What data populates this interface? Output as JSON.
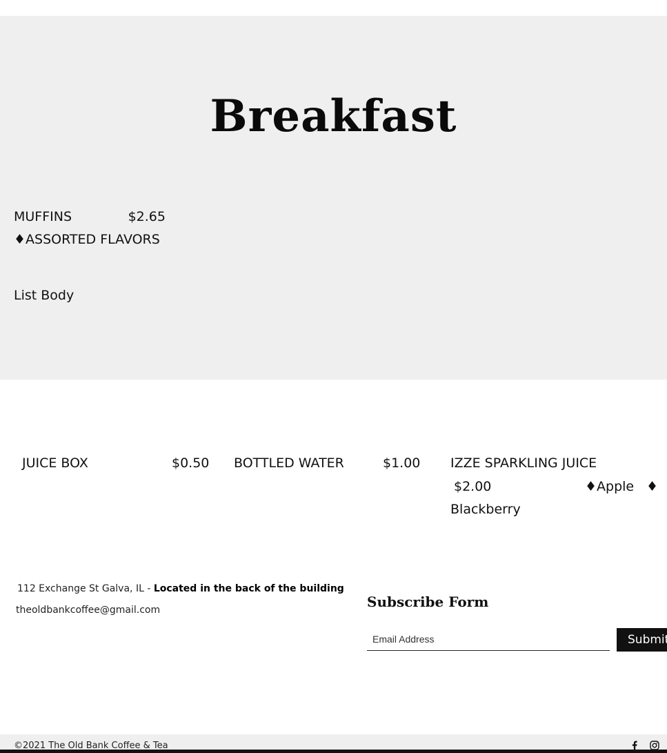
{
  "hero": {
    "title": "Breakfast",
    "muffins": {
      "name": "MUFFINS",
      "price": "$2.65",
      "desc": "♦ASSORTED FLAVORS"
    },
    "list_body": "List Body"
  },
  "drinks": [
    {
      "name": "JUICE BOX",
      "price": "$0.50"
    },
    {
      "name": "BOTTLED WATER",
      "price": "$1.00"
    },
    {
      "name": "IZZE SPARKLING JUICE",
      "price": "$2.00",
      "flavor1": "♦Apple",
      "flavor2": "♦",
      "flavor3": "Blackberry"
    }
  ],
  "footer": {
    "address": "112 Exchange St Galva, IL - ",
    "address_note": "Located in the back of the building",
    "email": "theoldbankcoffee@gmail.com"
  },
  "subscribe": {
    "title": "Subscribe Form",
    "placeholder": "Email Address",
    "submit": "Submit"
  },
  "bottom": {
    "copyright": "©2021 The Old Bank Coffee & Tea"
  },
  "icons": {
    "facebook": "facebook-icon",
    "instagram": "instagram-icon"
  }
}
